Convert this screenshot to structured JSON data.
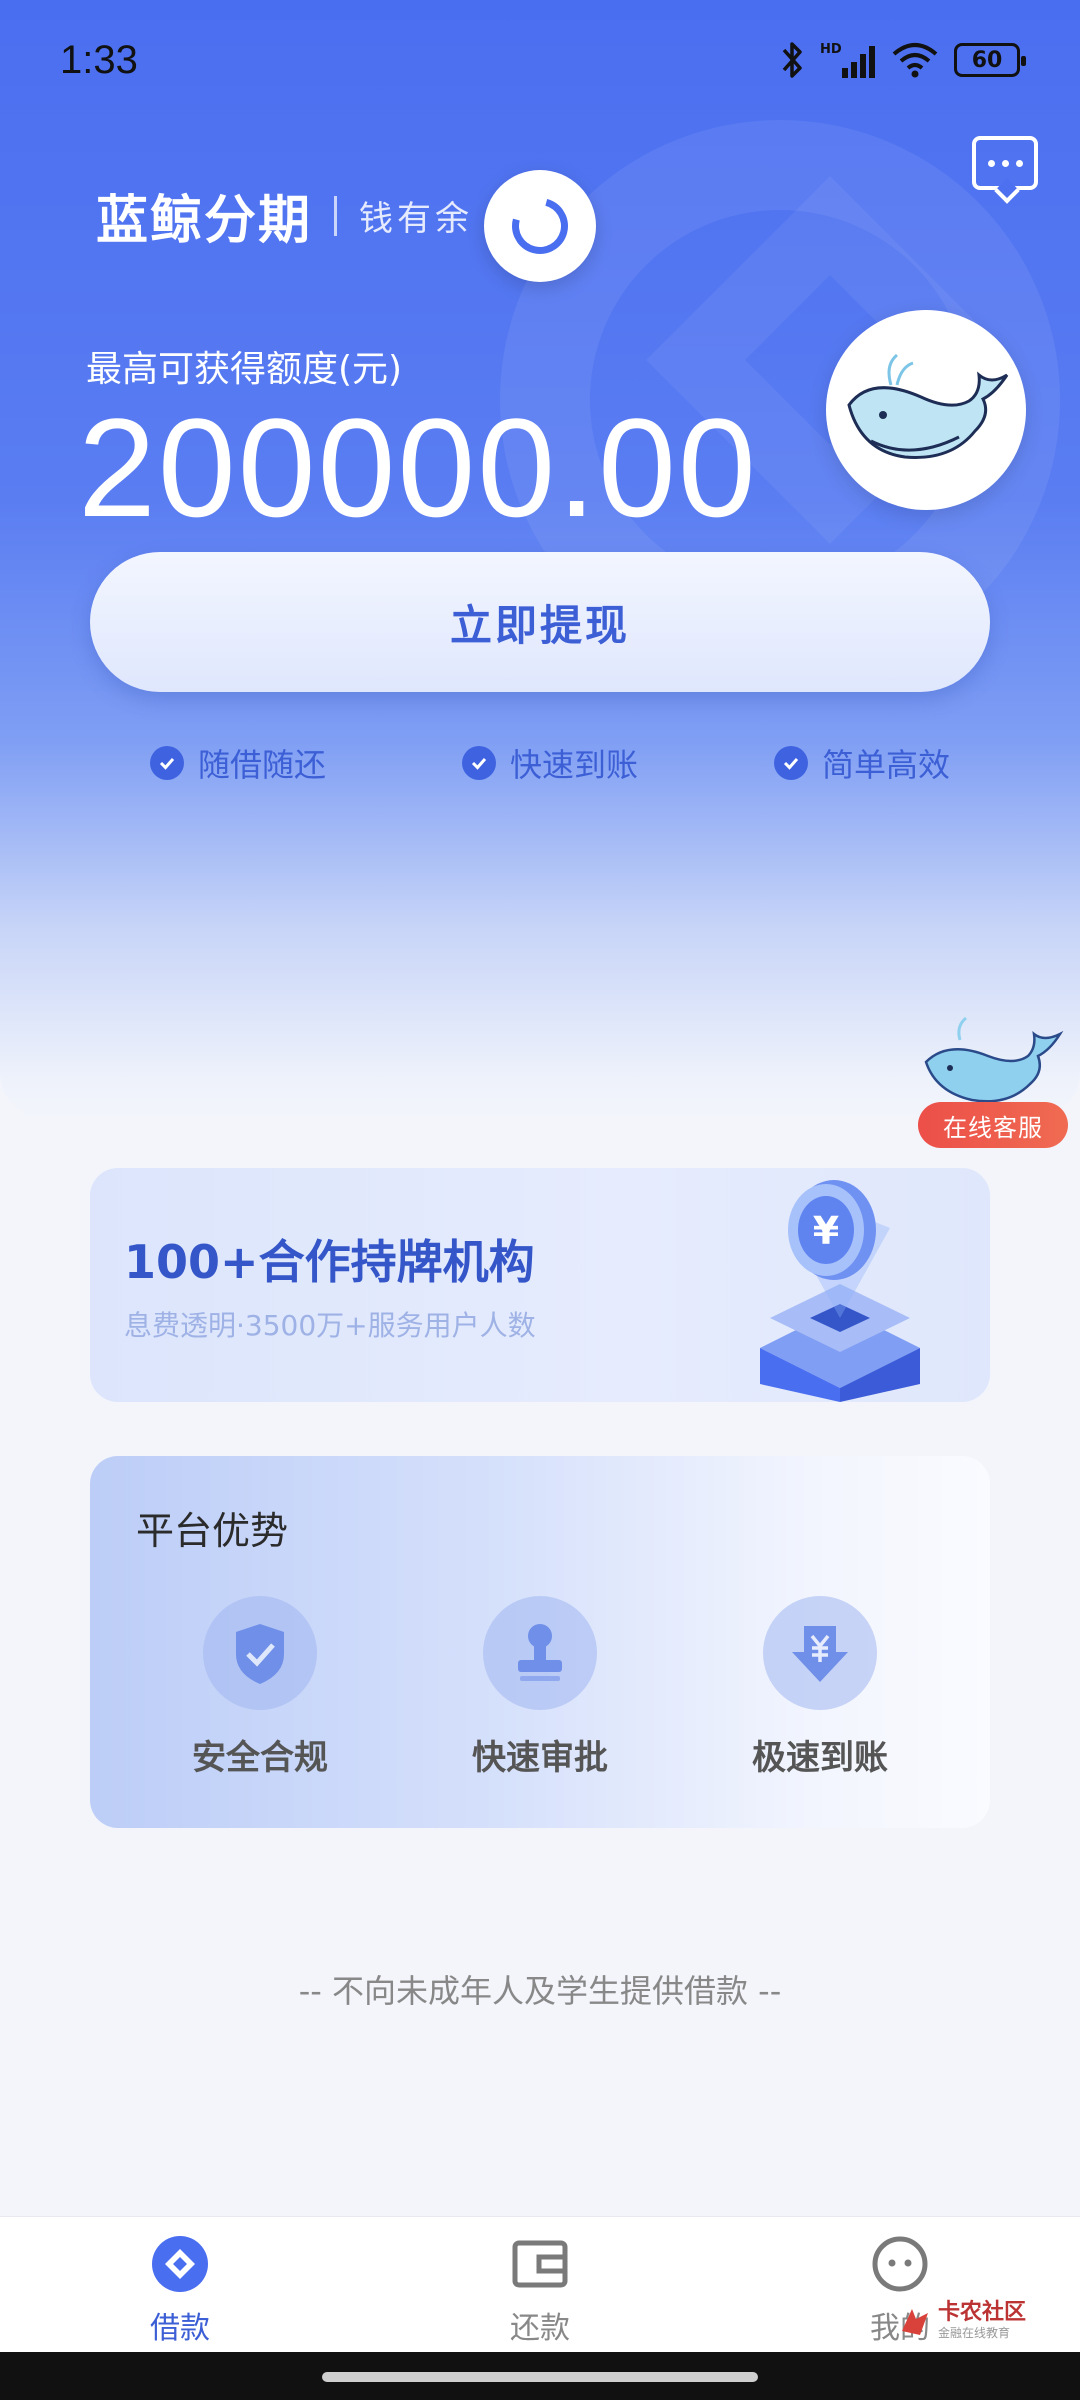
{
  "status_bar": {
    "time": "1:33",
    "network_label": "HD",
    "battery_level": "60"
  },
  "header": {
    "brand_name": "蓝鲸分期",
    "brand_sub": "钱有余",
    "message_icon": "message-icon"
  },
  "credit": {
    "label": "最高可获得额度(元)",
    "amount": "200000.00"
  },
  "primary_action": {
    "label": "立即提现"
  },
  "features": [
    {
      "label": "随借随还"
    },
    {
      "label": "快速到账"
    },
    {
      "label": "简单高效"
    }
  ],
  "customer_service": {
    "label": "在线客服"
  },
  "partners_card": {
    "title": "100+合作持牌机构",
    "subtitle": "息费透明·3500万+服务用户人数",
    "currency_symbol": "¥"
  },
  "advantages": {
    "title": "平台优势",
    "items": [
      {
        "label": "安全合规",
        "icon": "shield-check-icon"
      },
      {
        "label": "快速审批",
        "icon": "stamp-icon"
      },
      {
        "label": "极速到账",
        "icon": "download-yuan-icon"
      }
    ]
  },
  "disclaimer": "-- 不向未成年人及学生提供借款 --",
  "bottom_nav": {
    "items": [
      {
        "label": "借款",
        "icon": "loan-icon",
        "active": true
      },
      {
        "label": "还款",
        "icon": "wallet-icon",
        "active": false
      },
      {
        "label": "我的",
        "icon": "profile-icon",
        "active": false
      }
    ]
  },
  "watermark": {
    "title": "卡农社区",
    "subtitle": "金融在线教育"
  },
  "colors": {
    "primary": "#4a6ef0",
    "accent_text": "#3d5fd6",
    "service_badge": "#ec4f48",
    "page_bg": "#f3f5fb"
  }
}
